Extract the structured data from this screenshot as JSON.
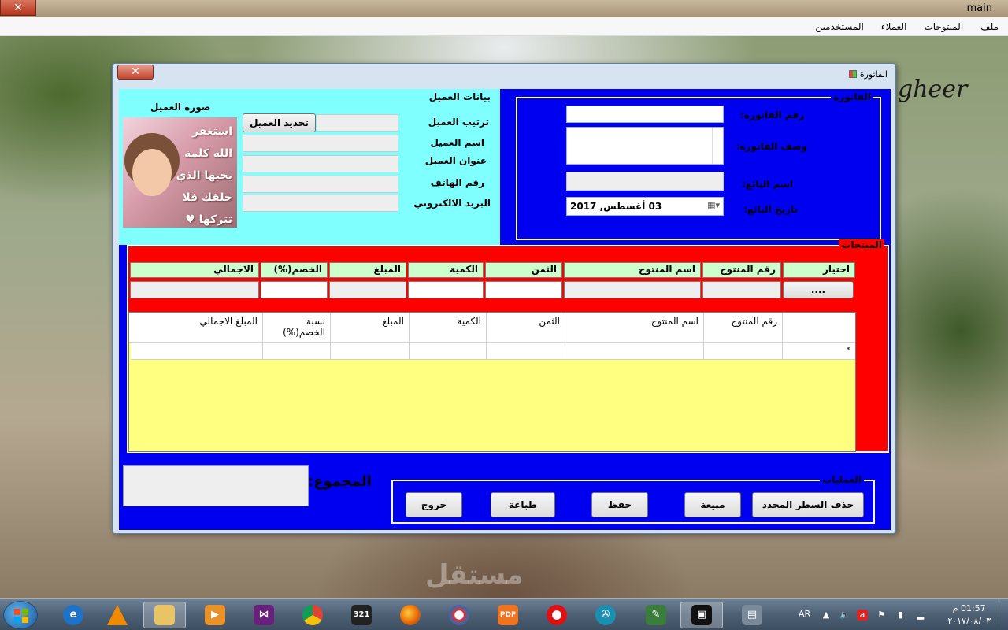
{
  "desktop": {
    "wallpaper_text": "gheer",
    "watermark": "مستقل"
  },
  "main_window": {
    "title": "main",
    "close_label": "✕",
    "menu": [
      "ملف",
      "المنتوجات",
      "العملاء",
      "المستخدمين"
    ]
  },
  "invoice_window": {
    "title": "الفاتورة",
    "close_label": "✕",
    "customer": {
      "group_title": "بيانات العميل",
      "photo_title": "صورة العميل",
      "photo_caption": "استغفر الله كلمة يحبها الذي خلقك فلا تتركها ♥",
      "select_button": "تحديد العميل",
      "fields": {
        "order_label": "ترتيب العميل",
        "name_label": "اسم العميل",
        "address_label": "عنوان العميل",
        "phone_label": "رقم الهاتف",
        "email_label": "البريد الالكتروني"
      }
    },
    "invoice": {
      "group_title": "الفاتورة",
      "number_label": "رقم الفاتورة:",
      "description_label": "وصف الفاتورة:",
      "seller_label": "اسم البائع:",
      "date_label": "تاريخ البائع:",
      "date_value": "03 أغسطس, 2017"
    },
    "products": {
      "group_title": "المنتجات",
      "headers": {
        "choose": "اختيار",
        "product_number": "رقم المنتوج",
        "product_name": "اسم المنتوج",
        "price": "الثمن",
        "quantity": "الكمية",
        "amount": "المبلغ",
        "discount": "الخصم(%)",
        "total": "الاجمالي"
      },
      "browse_button": "...."
    },
    "grid": {
      "columns": [
        "رقم المنتوج",
        "اسم المنتوج",
        "الثمن",
        "الكمية",
        "المبلغ",
        "نسبة الخصم(%)",
        "المبلغ الاجمالي"
      ],
      "new_row_marker": "*"
    },
    "total_label": "المجموع:",
    "operations": {
      "group_title": "العمليات",
      "buttons": [
        "حذف السطر المحدد",
        "مبيعة",
        "حفظ",
        "طباعة",
        "خروج"
      ]
    }
  },
  "taskbar": {
    "apps": [
      "internet-explorer",
      "vlc",
      "file-explorer",
      "media-player",
      "visual-studio",
      "chrome",
      "media-player-classic",
      "firefox",
      "pdf-app",
      "opera",
      "video-app",
      "tool-app",
      "briefcase-app",
      "window-app"
    ],
    "language": "AR",
    "time": "01:57 م",
    "date": "٢٠١٧/٠٨/٠٣"
  }
}
